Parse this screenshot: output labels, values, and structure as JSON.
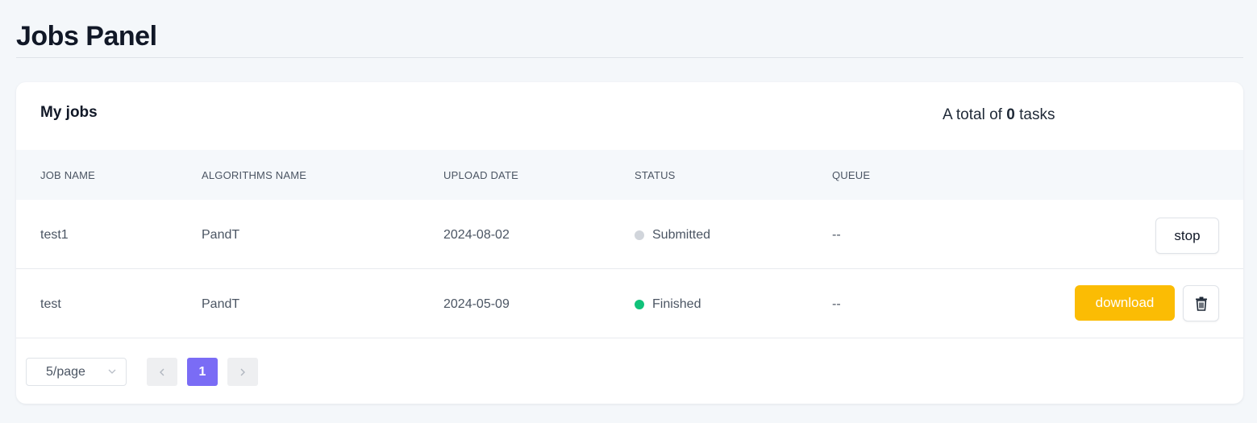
{
  "page": {
    "title": "Jobs Panel"
  },
  "card": {
    "title": "My jobs",
    "total_prefix": "A total of",
    "total_count": "0",
    "total_suffix": "tasks"
  },
  "table": {
    "columns": [
      "JOB NAME",
      "ALGORITHMS NAME",
      "UPLOAD DATE",
      "STATUS",
      "QUEUE"
    ],
    "rows": [
      {
        "job_name": "test1",
        "algorithm": "PandT",
        "upload_date": "2024-08-02",
        "status": "Submitted",
        "status_color": "#d1d5db",
        "queue": "--",
        "action_label": "stop"
      },
      {
        "job_name": "test",
        "algorithm": "PandT",
        "upload_date": "2024-05-09",
        "status": "Finished",
        "status_color": "#10c27a",
        "queue": "--",
        "action_label": "download",
        "secondary_icon": "trash-icon"
      }
    ]
  },
  "pagination": {
    "page_size": "5/page",
    "current_page": "1"
  },
  "colors": {
    "accent": "#7a6cf5",
    "download": "#fbbc04",
    "background": "#f4f7fa"
  }
}
